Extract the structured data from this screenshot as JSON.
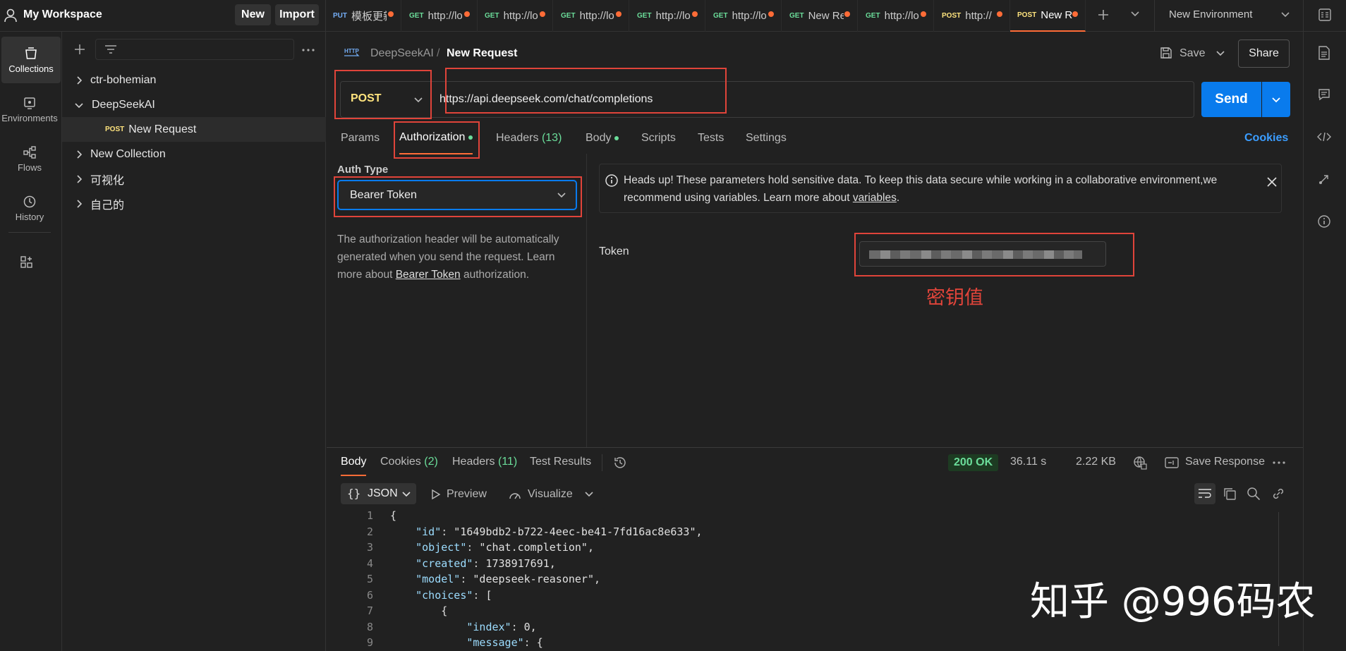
{
  "workspace": {
    "title": "My Workspace",
    "new_label": "New",
    "import_label": "Import"
  },
  "tabs": [
    {
      "method": "PUT",
      "title": "模板更新"
    },
    {
      "method": "GET",
      "title": "http://lo"
    },
    {
      "method": "GET",
      "title": "http://lo"
    },
    {
      "method": "GET",
      "title": "http://lo"
    },
    {
      "method": "GET",
      "title": "http://lo"
    },
    {
      "method": "GET",
      "title": "http://lo"
    },
    {
      "method": "GET",
      "title": "New Re"
    },
    {
      "method": "GET",
      "title": "http://lo"
    },
    {
      "method": "POST",
      "title": "http://"
    },
    {
      "method": "POST",
      "title": "New R"
    }
  ],
  "environment": {
    "selected": "New Environment"
  },
  "rail": [
    {
      "label": "Collections"
    },
    {
      "label": "Environments"
    },
    {
      "label": "Flows"
    },
    {
      "label": "History"
    }
  ],
  "sidebar": {
    "items": [
      {
        "label": "ctr-bohemian"
      },
      {
        "label": "DeepSeekAI"
      },
      {
        "method": "POST",
        "label": "New Request"
      },
      {
        "label": "New Collection"
      },
      {
        "label": "可视化"
      },
      {
        "label": "自己的"
      }
    ]
  },
  "request": {
    "breadcrumb_parent": "DeepSeekAI",
    "breadcrumb_sep": "/",
    "breadcrumb_current": "New Request",
    "save_label": "Save",
    "share_label": "Share",
    "method": "POST",
    "url": "https://api.deepseek.com/chat/completions",
    "send_label": "Send",
    "tabs": {
      "params": "Params",
      "authorization": "Authorization",
      "headers": "Headers",
      "headers_count": "(13)",
      "body": "Body",
      "scripts": "Scripts",
      "tests": "Tests",
      "settings": "Settings",
      "cookies": "Cookies"
    }
  },
  "auth": {
    "type_label": "Auth Type",
    "type_value": "Bearer Token",
    "desc_pre": "The authorization header will be automatically generated when you send the request. Learn more about ",
    "desc_link": "Bearer Token",
    "desc_post": " authorization.",
    "notice_text": "Heads up! These parameters hold sensitive data. To keep this data secure while working in a collaborative environment,we recommend using variables. Learn more about ",
    "notice_link": "variables",
    "notice_end": ".",
    "token_label": "Token",
    "annotation": "密钥值"
  },
  "response": {
    "tabs": {
      "body": "Body",
      "cookies": "Cookies",
      "cookies_count": "(2)",
      "headers": "Headers",
      "headers_count": "(11)",
      "tests": "Test Results"
    },
    "status": "200 OK",
    "time": "36.11 s",
    "size": "2.22 KB",
    "save_response": "Save Response",
    "format": "JSON",
    "preview": "Preview",
    "visualize": "Visualize"
  },
  "code_lines": [
    "{",
    "    \"id\": \"1649bdb2-b722-4eec-be41-7fd16ac8e633\",",
    "    \"object\": \"chat.completion\",",
    "    \"created\": 1738917691,",
    "    \"model\": \"deepseek-reasoner\",",
    "    \"choices\": [",
    "        {",
    "            \"index\": 0,",
    "            \"message\": {"
  ],
  "watermark": "知乎 @996码农",
  "colors": {
    "accent": "#ff6c37",
    "send": "#097bed",
    "annotation": "#e0443a"
  }
}
